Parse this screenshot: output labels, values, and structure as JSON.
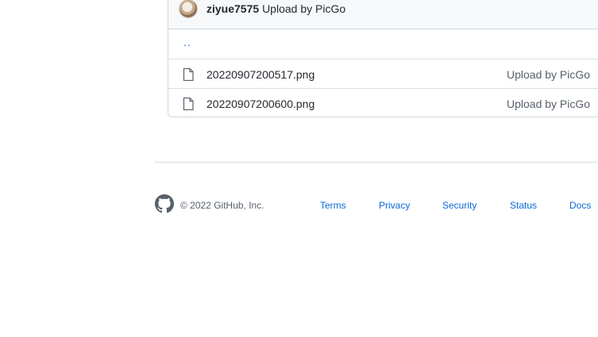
{
  "commit": {
    "author": "ziyue7575",
    "message": "Upload by PicGo"
  },
  "parent_link": "..",
  "files": [
    {
      "name": "20220907200517.png",
      "commit_message": "Upload by PicGo",
      "icon": "file-icon"
    },
    {
      "name": "20220907200600.png",
      "commit_message": "Upload by PicGo",
      "icon": "file-icon"
    }
  ],
  "footer": {
    "logo": "github-mark-icon",
    "copyright": "© 2022 GitHub, Inc.",
    "links": [
      "Terms",
      "Privacy",
      "Security",
      "Status",
      "Docs"
    ]
  },
  "colors": {
    "link": "#0969da",
    "muted": "#57606a",
    "border": "#d0d7de",
    "header_bg": "#f6f8fa"
  }
}
